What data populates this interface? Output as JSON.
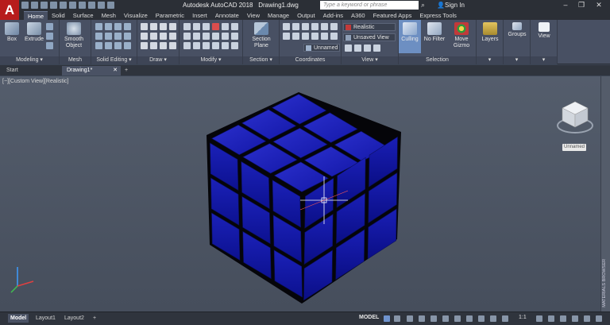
{
  "app": {
    "logo": "A",
    "title": "Autodesk AutoCAD 2018",
    "document": "Drawing1.dwg"
  },
  "search": {
    "placeholder": "Type a keyword or phrase"
  },
  "account": {
    "signin": "Sign In"
  },
  "window_controls": [
    "–",
    "❐",
    "✕"
  ],
  "ribbon_tabs": [
    "Home",
    "Solid",
    "Surface",
    "Mesh",
    "Visualize",
    "Parametric",
    "Insert",
    "Annotate",
    "View",
    "Manage",
    "Output",
    "Add-ins",
    "A360",
    "Featured Apps",
    "Express Tools"
  ],
  "active_tab": "Home",
  "panels": {
    "modeling": {
      "title": "Modeling ▾",
      "box": "Box",
      "extrude": "Extrude"
    },
    "mesh": {
      "title": "Mesh",
      "smooth": "Smooth",
      "smooth2": "Object"
    },
    "solid_editing": {
      "title": "Solid Editing ▾"
    },
    "draw": {
      "title": "Draw ▾"
    },
    "modify": {
      "title": "Modify ▾"
    },
    "section": {
      "title": "Section ▾",
      "plane": "Section",
      "plane2": "Plane"
    },
    "coordinates": {
      "title": "Coordinates",
      "ucs": "Unnamed"
    },
    "view": {
      "title": "View ▾",
      "visual_style": "Realistic",
      "saved_view": "Unsaved View"
    },
    "selection": {
      "title": "Selection",
      "culling": "Culling",
      "no_filter": "No Filter",
      "move_gizmo": "Move",
      "move_gizmo2": "Gizmo"
    },
    "layers": {
      "title": "Layers"
    },
    "groups": {
      "title": "Groups"
    },
    "view2": {
      "title": "View"
    }
  },
  "doc_tabs": [
    "Start",
    "Drawing1*"
  ],
  "viewport": {
    "label": "[−][Custom View][Realistic]",
    "ucs_name": "Unnamed",
    "side_palette": "MATERIALS BROWSER"
  },
  "status": {
    "layouts": [
      "Model",
      "Layout1",
      "Layout2"
    ],
    "model": "MODEL",
    "scale": "1:1"
  },
  "colors": {
    "accent": "#0b1296",
    "cube_top": "#1a1fb4",
    "ribbon": "#485063",
    "background": "#3b4453"
  }
}
